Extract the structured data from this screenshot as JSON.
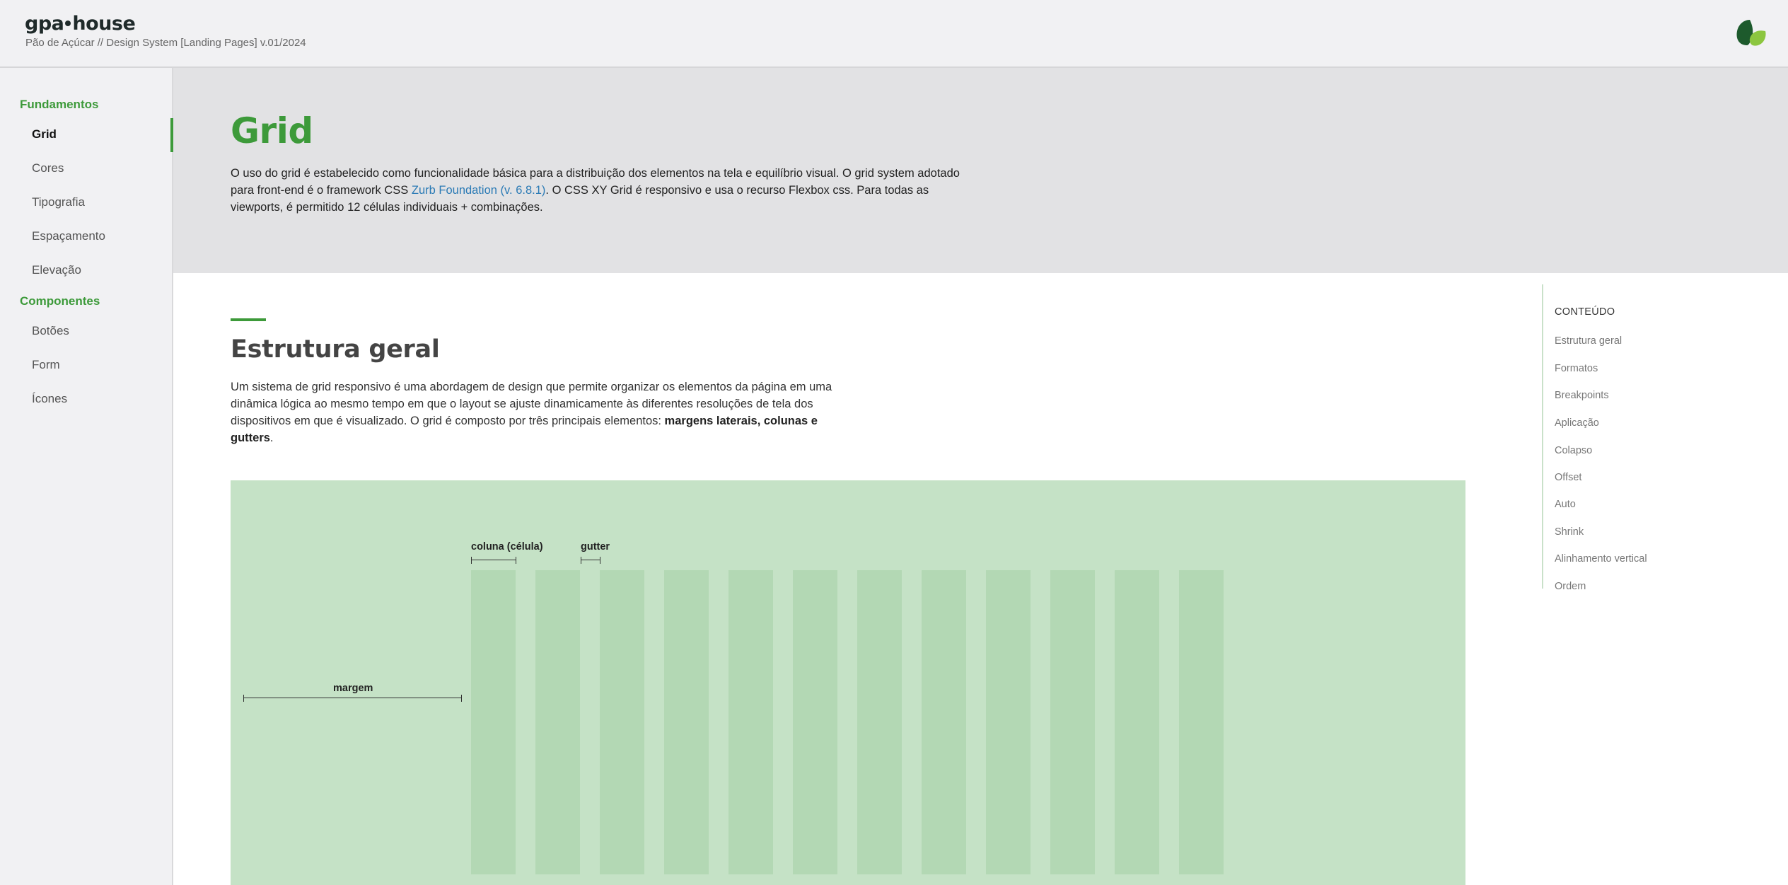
{
  "header": {
    "brand_left": "gpa",
    "brand_right": "house",
    "subtitle": "Pão de Açúcar // Design System [Landing Pages] v.01/2024",
    "logo_icon": "leaf-logo-icon",
    "colors": {
      "dark_green": "#1d5a2c",
      "light_green": "#8cc63f"
    }
  },
  "sidebar": {
    "sections": [
      {
        "label": "Fundamentos",
        "items": [
          "Grid",
          "Cores",
          "Tipografia",
          "Espaçamento",
          "Elevação"
        ]
      },
      {
        "label": "Componentes",
        "items": [
          "Botões",
          "Form",
          "Ícones"
        ]
      }
    ],
    "active_item": "Grid"
  },
  "hero": {
    "title": "Grid",
    "text_before_link": "O uso do grid é estabelecido como funcionalidade básica para a distribuição dos elementos na tela e equilíbrio visual. O grid system adotado para front-end é o framework CSS ",
    "link_text": "Zurb Foundation (v. 6.8.1)",
    "text_after_link": ". O CSS XY Grid é responsivo e usa o recurso Flexbox css. Para todas as viewports, é permitido 12 células individuais + combinações."
  },
  "section": {
    "title": "Estrutura geral",
    "text": "Um sistema de grid responsivo é uma abordagem de design que permite organizar os elementos da página em uma dinâmica lógica ao mesmo tempo em que o layout se ajuste dinamicamente às diferentes resoluções de tela dos dispositivos em que é visualizado. O grid é composto por três principais elementos: ",
    "text_bold": "margens laterais, colunas e gutters",
    "text_end": "."
  },
  "illustration": {
    "column_label": "coluna (célula)",
    "gutter_label": "gutter",
    "margin_label": "margem",
    "column_count": 12,
    "colors": {
      "background": "#c5e2c6",
      "column": "#b3d8b4"
    }
  },
  "toc": {
    "heading": "CONTEÚDO",
    "items": [
      "Estrutura geral",
      "Formatos",
      "Breakpoints",
      "Aplicação",
      "Colapso",
      "Offset",
      "Auto",
      "Shrink",
      "Alinhamento vertical",
      "Ordem"
    ]
  },
  "colors": {
    "accent": "#3d9a3a",
    "link": "#2a7ab5"
  }
}
